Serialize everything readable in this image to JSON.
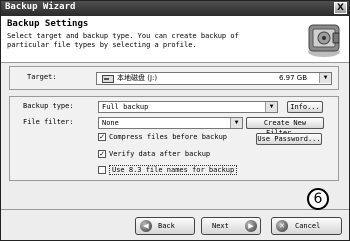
{
  "window": {
    "title": "Backup Wizard",
    "close_label": "X"
  },
  "header": {
    "title": "Backup Settings",
    "description": "Select target and backup type. You can create backup of particular file types by selecting a profile."
  },
  "target": {
    "label": "Target:",
    "drive_name": "本地磁盘 (J:)",
    "drive_size": "6.97 GB"
  },
  "settings": {
    "backup_type_label": "Backup type:",
    "backup_type_value": "Full backup",
    "info_button": "Info...",
    "file_filter_label": "File filter:",
    "file_filter_value": "None",
    "create_filter_button": "Create New Filter...",
    "use_password_button": "Use Password...",
    "checkboxes": [
      {
        "label": "Compress files before backup",
        "checked": true
      },
      {
        "label": "Verify data after backup",
        "checked": true
      },
      {
        "label": "Use 8.3 file names for backup",
        "checked": false
      }
    ]
  },
  "footer": {
    "back_label": "Back",
    "next_label": "Next",
    "cancel_label": "Cancel"
  },
  "annotation": {
    "step_number": "6"
  }
}
